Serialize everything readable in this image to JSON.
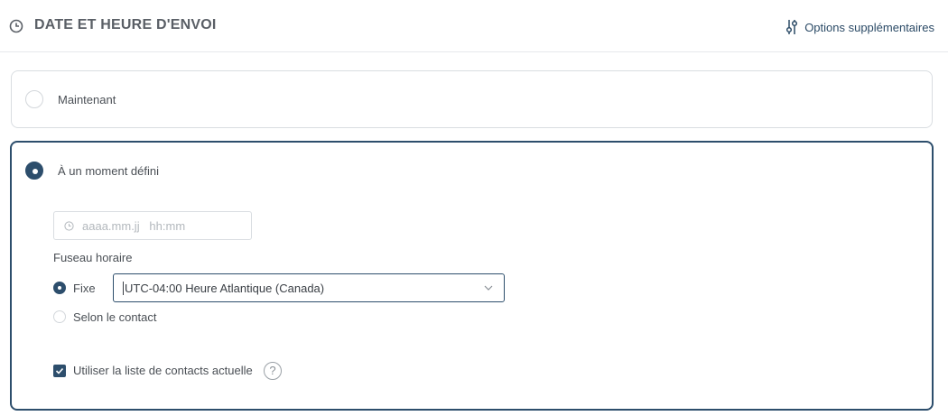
{
  "header": {
    "title": "DATE ET HEURE D'ENVOI",
    "title_icon": "clock-icon",
    "options_label": "Options supplémentaires",
    "options_icon": "tune-icon"
  },
  "send_time": {
    "now_label": "Maintenant",
    "now_selected": false,
    "defined_label": "À un moment défini",
    "defined_selected": true
  },
  "datetime_input": {
    "placeholder": "aaaa.mm.jj   hh:mm",
    "icon": "clock-icon"
  },
  "timezone": {
    "title": "Fuseau horaire",
    "fixed_label": "Fixe",
    "fixed_selected": true,
    "contact_label": "Selon le contact",
    "contact_selected": false,
    "selected_value": "UTC-04:00 Heure Atlantique (Canada)"
  },
  "contacts": {
    "checkbox_label": "Utiliser la liste de contacts actuelle",
    "checked": true,
    "help_symbol": "?"
  },
  "colors": {
    "accent": "#2d4e6c",
    "border": "#d9dde1",
    "text": "#4a4f55"
  }
}
